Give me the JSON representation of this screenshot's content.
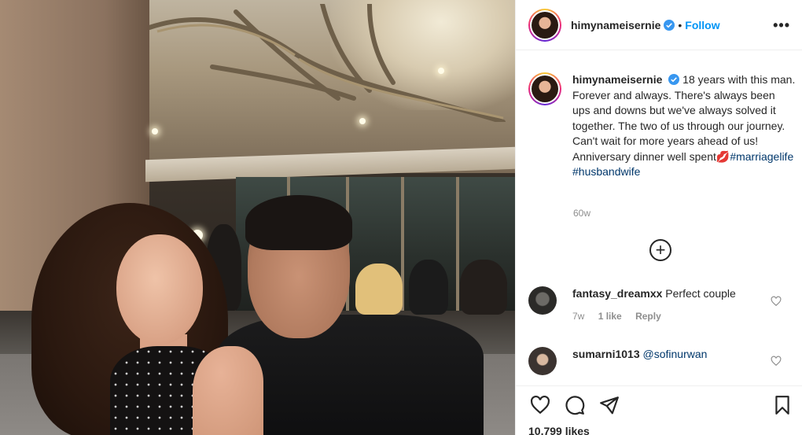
{
  "post": {
    "username": "himynameisernie",
    "follow_label": "Follow",
    "separator": "•",
    "more_label": "•••"
  },
  "caption": {
    "username": "himynameisernie",
    "text": " 18 years with this man. Forever and always. There's always been ups and downs but we've always solved it together. The two of us through our journey. Can't wait for more years ahead of us! Anniversary dinner well spent",
    "emoji": "💋",
    "hashtags": [
      "#marriagelife",
      "#husbandwife"
    ],
    "time_ago": "60w"
  },
  "load_more": {
    "icon": "plus-circle-icon"
  },
  "comments": [
    {
      "username": "fantasy_dreamxx",
      "text": "Perfect couple",
      "time": "7w",
      "likes": "1 like",
      "reply": "Reply"
    },
    {
      "username": "sumarni1013",
      "text": "@sofinurwan",
      "time": "",
      "likes": "",
      "reply": ""
    }
  ],
  "actions": {
    "icons": [
      "heart-icon",
      "comment-icon",
      "share-icon",
      "bookmark-icon"
    ],
    "likes_count": "10,799 likes"
  },
  "colors": {
    "link": "#0095f6",
    "hashtag": "#00376b",
    "muted": "#8e8e8e",
    "verified": "#3897f0"
  }
}
